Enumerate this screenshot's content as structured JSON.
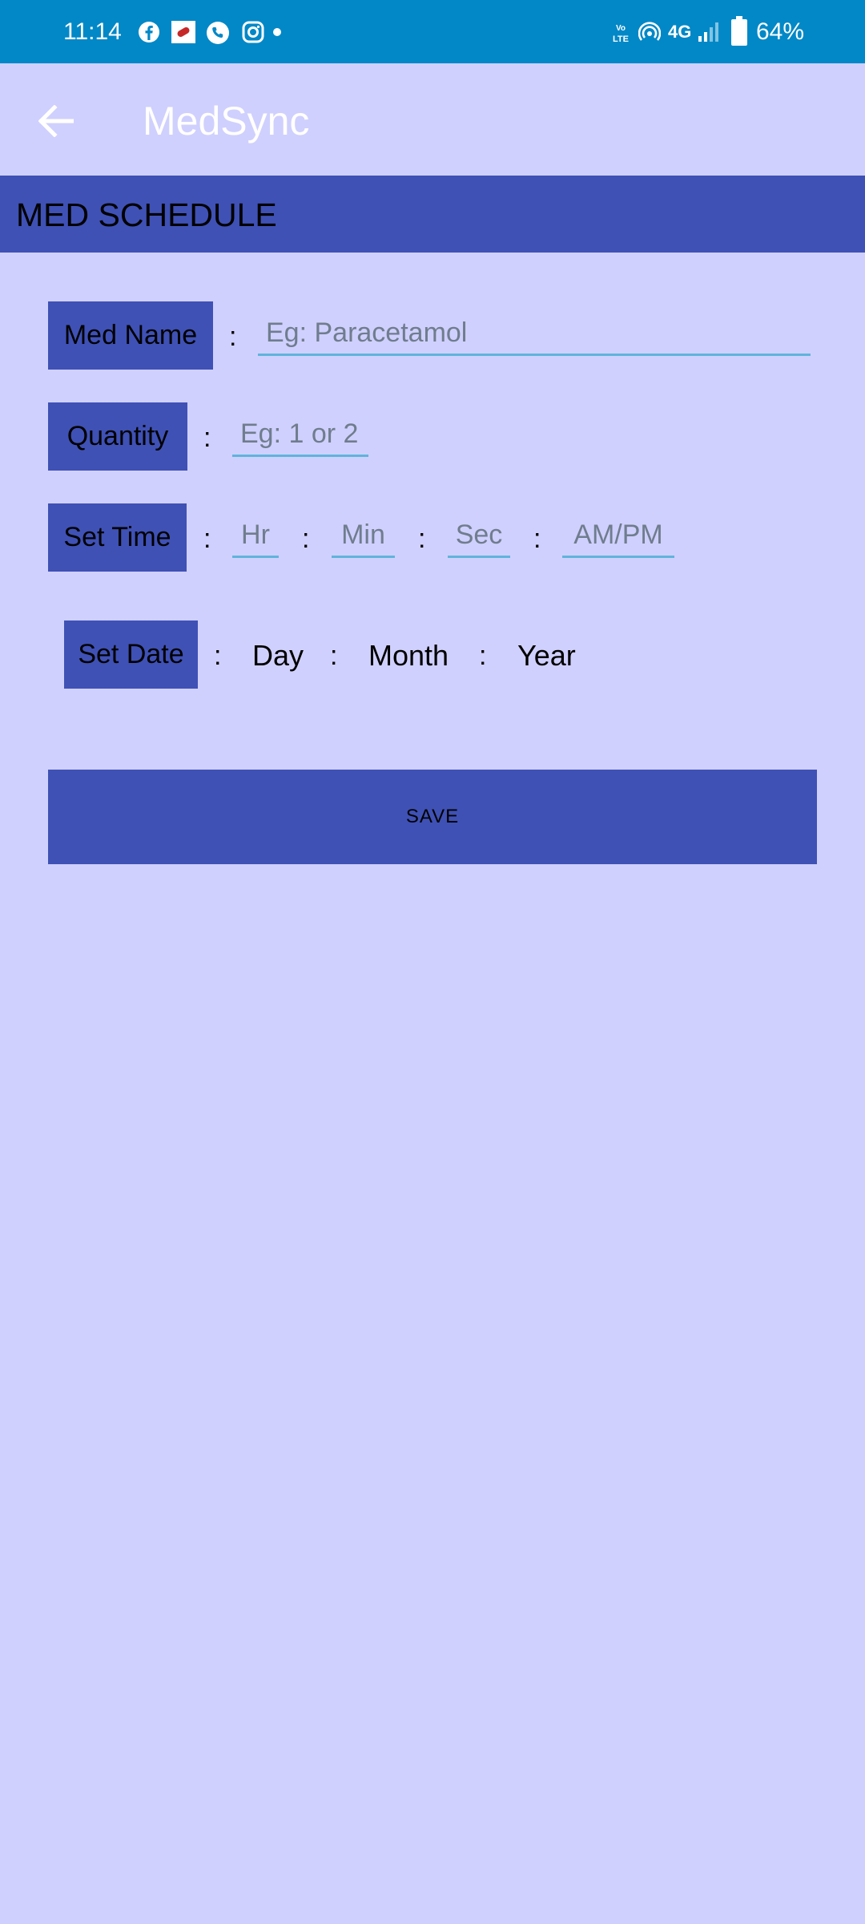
{
  "status_bar": {
    "time": "11:14",
    "network": "4G",
    "battery": "64%",
    "left_icons": [
      "facebook-icon",
      "app-notification-icon",
      "phone-icon",
      "instagram-icon"
    ],
    "right_icons": [
      "volte-icon",
      "hotspot-icon",
      "signal-icon",
      "battery-icon"
    ],
    "color": "#0288C7"
  },
  "app_bar": {
    "back_icon": "arrow-left-icon",
    "title": "MedSync"
  },
  "section": {
    "title": "MED SCHEDULE",
    "color": "#3F51B5"
  },
  "form": {
    "separator": ":",
    "med_name": {
      "label": "Med Name",
      "value": "",
      "placeholder": "Eg: Paracetamol"
    },
    "quantity": {
      "label": "Quantity",
      "value": "",
      "placeholder": "Eg: 1 or 2"
    },
    "set_time": {
      "label": "Set Time",
      "hour_placeholder": "Hr",
      "minute_placeholder": "Min",
      "second_placeholder": "Sec",
      "ampm_placeholder": "AM/PM"
    },
    "set_date": {
      "label": "Set Date",
      "day": "Day",
      "month": "Month",
      "year": "Year"
    }
  },
  "save_button": {
    "label": "SAVE"
  },
  "colors": {
    "background": "#D0D0FE",
    "accent": "#3F51B5",
    "underline": "#5FB4DB",
    "placeholder": "#6F7D8E"
  }
}
